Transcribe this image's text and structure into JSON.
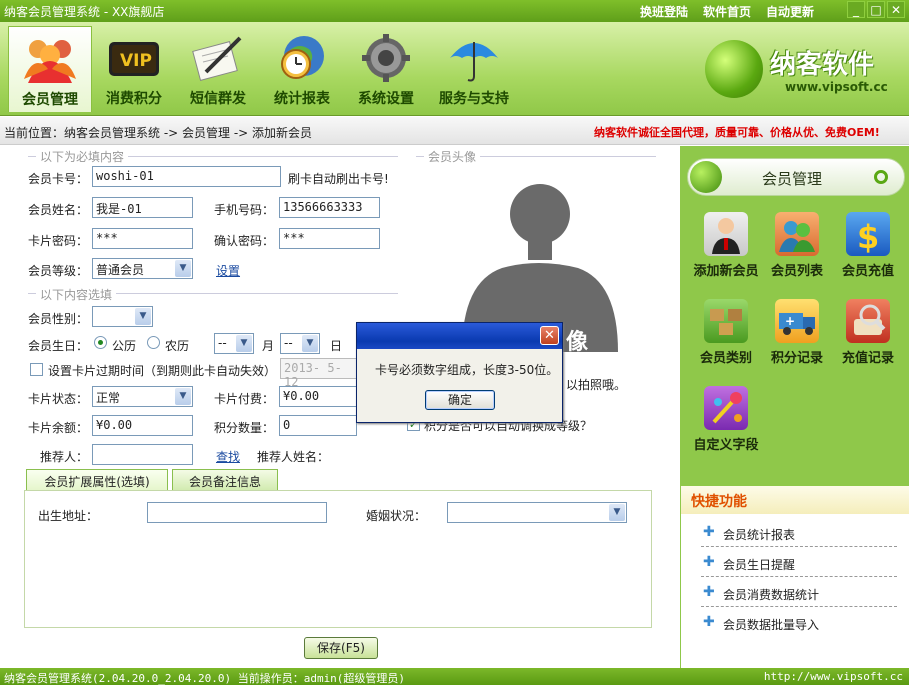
{
  "window": {
    "title": "纳客会员管理系统 - XX旗舰店",
    "links": [
      "换班登陆",
      "软件首页",
      "自动更新"
    ]
  },
  "toolbar": {
    "items": [
      {
        "label": "会员管理",
        "icon": "members-icon"
      },
      {
        "label": "消费积分",
        "icon": "vip-card-icon"
      },
      {
        "label": "短信群发",
        "icon": "letter-pen-icon"
      },
      {
        "label": "统计报表",
        "icon": "clock-globe-icon"
      },
      {
        "label": "系统设置",
        "icon": "gear-icon"
      },
      {
        "label": "服务与支持",
        "icon": "umbrella-icon"
      }
    ],
    "active_index": 0
  },
  "brand": {
    "name": "纳客软件",
    "url": "www.vipsoft.cc"
  },
  "breadcrumb": {
    "text": "当前位置：纳客会员管理系统 -> 会员管理 -> 添加新会员",
    "ad": "纳客软件诚征全国代理，质量可靠、价格从优、免费OEM!"
  },
  "form": {
    "required_section": "以下为必填内容",
    "optional_section": "以下内容选填",
    "photo_section": "会员头像",
    "photo_placeholder": "像",
    "photo_hint": "以拍照哦。",
    "card_no_label": "会员卡号：",
    "card_no_value": "woshi-01",
    "card_no_hint": "刷卡自动刷出卡号!",
    "name_label": "会员姓名：",
    "name_value": "我是-01",
    "phone_label": "手机号码：",
    "phone_value": "13566663333",
    "pwd_label": "卡片密码：",
    "pwd_value": "***",
    "pwd_confirm_label": "确认密码：",
    "pwd_confirm_value": "***",
    "level_label": "会员等级：",
    "level_value": "普通会员",
    "level_link": "设置",
    "gender_label": "会员性别：",
    "gender_value": "",
    "birthday_label": "会员生日：",
    "solar_label": "公历",
    "lunar_label": "农历",
    "month_value": "--",
    "month_unit": "月",
    "day_value": "--",
    "day_unit": "日",
    "expiry_label": "设置卡片过期时间（到期则此卡自动失效）",
    "expiry_value": "2013- 5-12",
    "status_label": "卡片状态：",
    "status_value": "正常",
    "fee_label": "卡片付费：",
    "fee_value": "¥0.00",
    "balance_label": "卡片余额：",
    "balance_value": "¥0.00",
    "points_label": "积分数量：",
    "points_value": "0",
    "points_upgrade_label": "积分是否可以自动调换成等级？",
    "referrer_label": "推荐人：",
    "referrer_value": "",
    "find_link": "查找",
    "referrer_name_label": "推荐人姓名："
  },
  "tabs": {
    "items": [
      "会员扩展属性(选填)",
      "会员备注信息"
    ],
    "active_index": 0
  },
  "ext": {
    "birthplace_label": "出生地址：",
    "birthplace_value": "",
    "marital_label": "婚姻状况：",
    "marital_value": ""
  },
  "save_button": "保存(F5)",
  "dialog": {
    "message": "卡号必须数字组成，长度3-50位。",
    "ok_label": "确定",
    "close_glyph": "✕"
  },
  "sidebar": {
    "title": "会员管理",
    "items": [
      {
        "label": "添加新会员",
        "icon": "add-member-icon"
      },
      {
        "label": "会员列表",
        "icon": "member-list-icon"
      },
      {
        "label": "会员充值",
        "icon": "dollar-icon"
      },
      {
        "label": "会员类别",
        "icon": "member-category-icon"
      },
      {
        "label": "积分记录",
        "icon": "points-truck-icon"
      },
      {
        "label": "充值记录",
        "icon": "recharge-record-icon"
      },
      {
        "label": "自定义字段",
        "icon": "custom-field-icon"
      }
    ],
    "quick_title": "快捷功能",
    "quick_items": [
      "会员统计报表",
      "会员生日提醒",
      "会员消费数据统计",
      "会员数据批量导入"
    ]
  },
  "statusbar": {
    "left": "纳客会员管理系统(2.04.20.0_2.04.20.0) 当前操作员：admin(超级管理员)",
    "right": "http://www.vipsoft.cc"
  }
}
